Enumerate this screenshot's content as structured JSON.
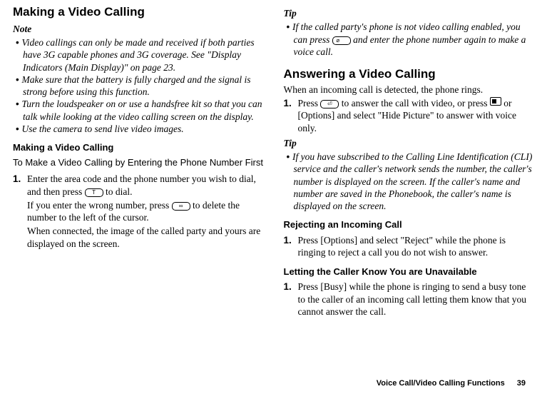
{
  "left": {
    "h1": "Making a Video Calling",
    "note_label": "Note",
    "notes": [
      "Video callings can only be made and received if both parties have 3G capable phones and 3G coverage. See \"Display Indicators (Main Display)\" on page 23.",
      "Make sure that the battery is fully charged and the signal is strong before using this function.",
      "Turn the loudspeaker on or use a handsfree kit so that you can talk while looking at the video calling screen on the display.",
      "Use the camera to send live video images."
    ],
    "h3": "Making a Video Calling",
    "h4": "To Make a Video Calling by Entering the Phone Number First",
    "step1a": "Enter the area code and the phone number you wish to dial, and then press ",
    "step1b": " to dial.",
    "cont1a": "If you enter the wrong number, press ",
    "cont1b": " to delete the number to the left of the cursor.",
    "cont2": "When connected, the image of the called party and yours are displayed on the screen."
  },
  "right": {
    "tip_label": "Tip",
    "tip1a": "If the called party's phone is not video calling enabled, you can press ",
    "tip1b": " and enter the phone number again to make a voice call.",
    "h2": "Answering a Video Calling",
    "intro": "When an incoming call is detected, the phone rings.",
    "step1a": "Press ",
    "step1b": " to answer the call with video, or press ",
    "step1c": " or [Options] and select \"Hide Picture\" to answer with voice only.",
    "tip2_label": "Tip",
    "tip2": "If you have subscribed to the Calling Line Identification (CLI) service and the caller's network sends the number, the caller's number is displayed on the screen. If the caller's name and number are saved in the Phonebook, the caller's name is displayed on the screen.",
    "h3a": "Rejecting an Incoming Call",
    "rej_step": "Press [Options] and select \"Reject\" while the phone is ringing to reject a call you do not wish to answer.",
    "h3b": "Letting the Caller Know You are Unavailable",
    "busy_step": "Press [Busy] while the phone is ringing to send a busy tone to the caller of an incoming call letting them know that you cannot answer the call."
  },
  "footer": {
    "section": "Voice Call/Video Calling Functions",
    "page": "39"
  },
  "keys": {
    "video": "☐",
    "clear": "",
    "end": "",
    "answer": ""
  }
}
